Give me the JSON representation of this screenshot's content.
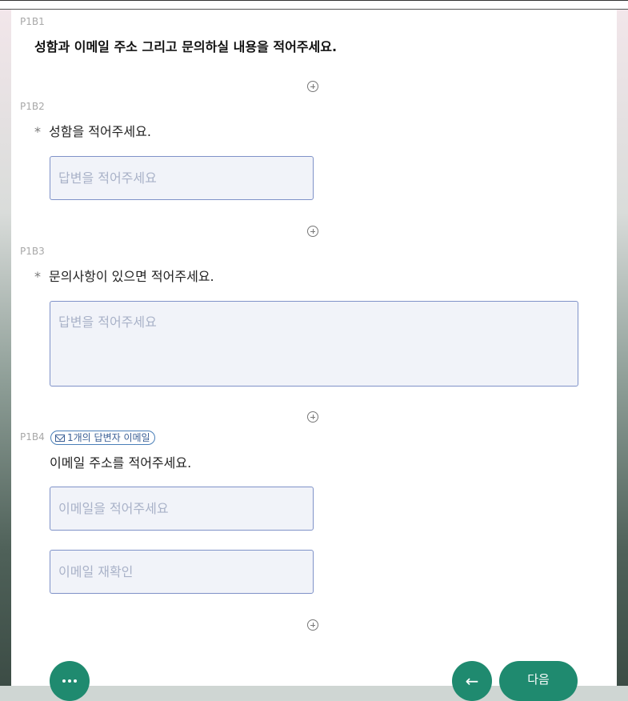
{
  "blocks": [
    {
      "label": "P1B1",
      "title": "성함과 이메일 주소 그리고 문의하실 내용을 적어주세요."
    },
    {
      "label": "P1B2",
      "required": "*",
      "question": "성함을 적어주세요.",
      "placeholder": "답변을 적어주세요"
    },
    {
      "label": "P1B3",
      "required": "*",
      "question": "문의사항이 있으면 적어주세요.",
      "placeholder": "답변을 적어주세요"
    },
    {
      "label": "P1B4",
      "badge": "1개의 답변자 이메일",
      "question": "이메일 주소를 적어주세요.",
      "placeholder": "이메일을 적어주세요",
      "confirm_placeholder": "이메일 재확인"
    }
  ],
  "nav": {
    "more_icon": "ellipsis-icon",
    "back_icon": "arrow-left-icon",
    "back_glyph": "←",
    "next_label": "다음"
  },
  "colors": {
    "accent": "#1f8a6f",
    "field_border": "#7f92c8",
    "badge": "#3b5f95"
  }
}
